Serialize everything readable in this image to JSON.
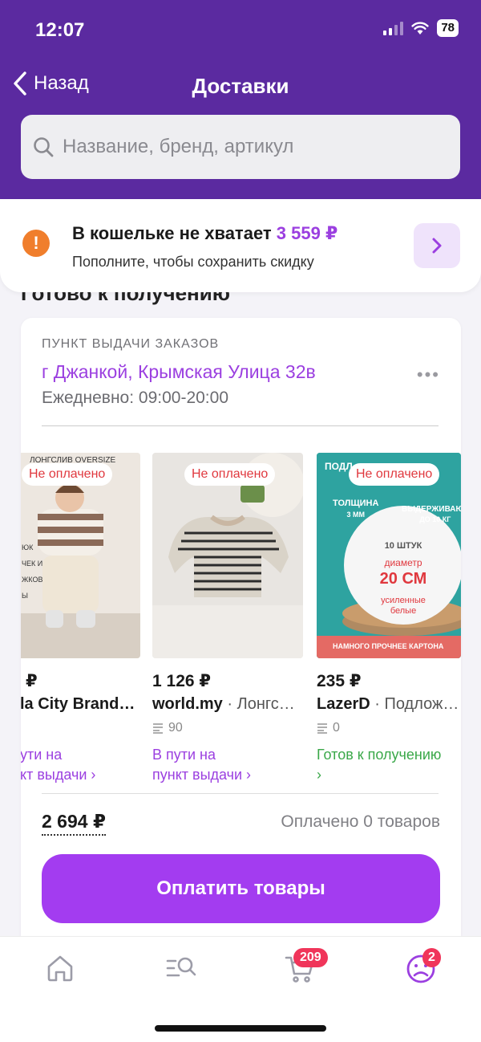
{
  "status_bar": {
    "time": "12:07",
    "battery": "78"
  },
  "nav": {
    "back_label": "Назад",
    "title": "Доставки"
  },
  "search": {
    "placeholder": "Название, бренд, артикул"
  },
  "wallet_banner": {
    "title": "В кошельке не хватает",
    "amount": "3 559 ₽",
    "subtitle": "Пополните, чтобы сохранить скидку"
  },
  "section_title": "Готово к получению",
  "pickup": {
    "label": "ПУНКТ ВЫДАЧИ ЗАКАЗОВ",
    "address": "г Джанкой, Крымская Улица 32в",
    "hours": "Ежедневно: 09:00-20:00"
  },
  "products": [
    {
      "badge": "Не оплачено",
      "price": "₽",
      "brand": "la City Brand…",
      "category": "",
      "reviews": "",
      "status_line1": "ути на",
      "status_line2": "кт выдачи ›",
      "status_color": "purple",
      "photo_text": "ЛОНГСЛИВ OVERSIZE",
      "photo_side": [
        "ЮК",
        "ЧЕК И",
        "ЖКОВ",
        "Ы"
      ]
    },
    {
      "badge": "Не оплачено",
      "price": "1 126 ₽",
      "brand": "world.my",
      "category": " · Лонгс…",
      "reviews": "90",
      "status_line1": "В пути на",
      "status_line2": "пункт выдачи ›",
      "status_color": "purple"
    },
    {
      "badge": "Не оплачено",
      "price": "235 ₽",
      "brand": "LazerD",
      "category": " · Подлож…",
      "reviews": "0",
      "status_line1": "Готов к получению",
      "status_line2": "›",
      "status_color": "green",
      "photo_top": "ПОДЛ",
      "photo_thickness": "ТОЛЩИНА",
      "photo_thickness_val": "3 ММ",
      "photo_load": "ВЫДЕРЖИВАЮТ",
      "photo_load_val": "ДО 10 КГ",
      "photo_count": "10 ШТУК",
      "photo_diam": "диаметр",
      "photo_size": "20 СМ",
      "photo_reinforced": "усиленные",
      "photo_white": "белые",
      "photo_bottom": "НАМНОГО ПРОЧНЕЕ КАРТОНА"
    }
  ],
  "summary": {
    "total": "2 694 ₽",
    "paid": "Оплачено 0 товаров"
  },
  "pay_button": "Оплатить товары",
  "tabbar": {
    "cart_count": "209",
    "profile_count": "2"
  },
  "colors": {
    "header": "#5b2aa0",
    "accent": "#9b3fe0",
    "pay_button": "#a33cf0",
    "badge_text": "#e0383e",
    "counter": "#f0355a",
    "warning": "#f07e2c"
  }
}
